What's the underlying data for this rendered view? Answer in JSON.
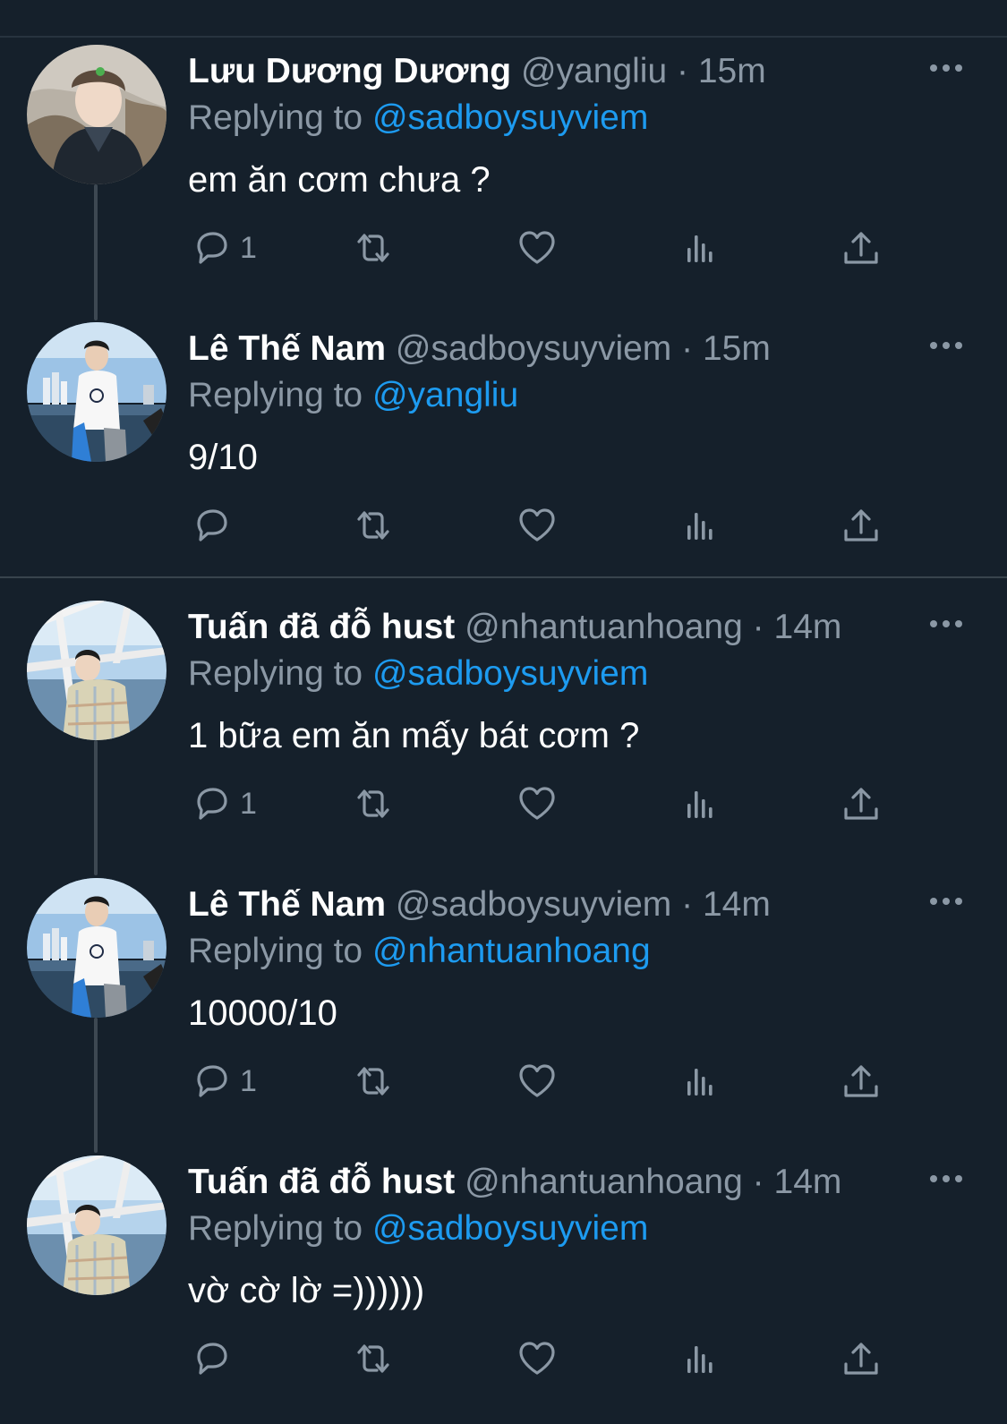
{
  "tweets": [
    {
      "name": "Lưu Dương Dương",
      "handle": "@yangliu",
      "separator": "·",
      "time": "15m",
      "replying_label": "Replying to",
      "replying_to": "@sadboysuyviem",
      "text": "em ăn cơm chưa ?",
      "reply_count": "1",
      "avatar_theme": "cliff-portrait"
    },
    {
      "name": "Lê Thế Nam",
      "handle": "@sadboysuyviem",
      "separator": "·",
      "time": "15m",
      "replying_label": "Replying to",
      "replying_to": "@yangliu",
      "text": "9/10",
      "reply_count": "",
      "avatar_theme": "boat-city"
    },
    {
      "name": "Tuấn đã đỗ hust",
      "handle": "@nhantuanhoang",
      "separator": "·",
      "time": "14m",
      "replying_label": "Replying to",
      "replying_to": "@sadboysuyviem",
      "text": "1 bữa em ăn mấy bát cơm ?",
      "reply_count": "1",
      "avatar_theme": "boat-sea"
    },
    {
      "name": "Lê Thế Nam",
      "handle": "@sadboysuyviem",
      "separator": "·",
      "time": "14m",
      "replying_label": "Replying to",
      "replying_to": "@nhantuanhoang",
      "text": "10000/10",
      "reply_count": "1",
      "avatar_theme": "boat-city"
    },
    {
      "name": "Tuấn đã đỗ hust",
      "handle": "@nhantuanhoang",
      "separator": "·",
      "time": "14m",
      "replying_label": "Replying to",
      "replying_to": "@sadboysuyviem",
      "text": "vờ cờ lờ =))))))",
      "reply_count": "",
      "avatar_theme": "boat-sea"
    }
  ],
  "icons": {
    "more": "more-horizontal-icon",
    "reply": "reply-icon",
    "retweet": "retweet-icon",
    "like": "heart-icon",
    "views": "views-icon",
    "share": "share-icon"
  },
  "colors": {
    "background": "#15202b",
    "mention": "#1d9bf0",
    "secondary_text": "#8b98a5",
    "divider": "#38444d"
  }
}
